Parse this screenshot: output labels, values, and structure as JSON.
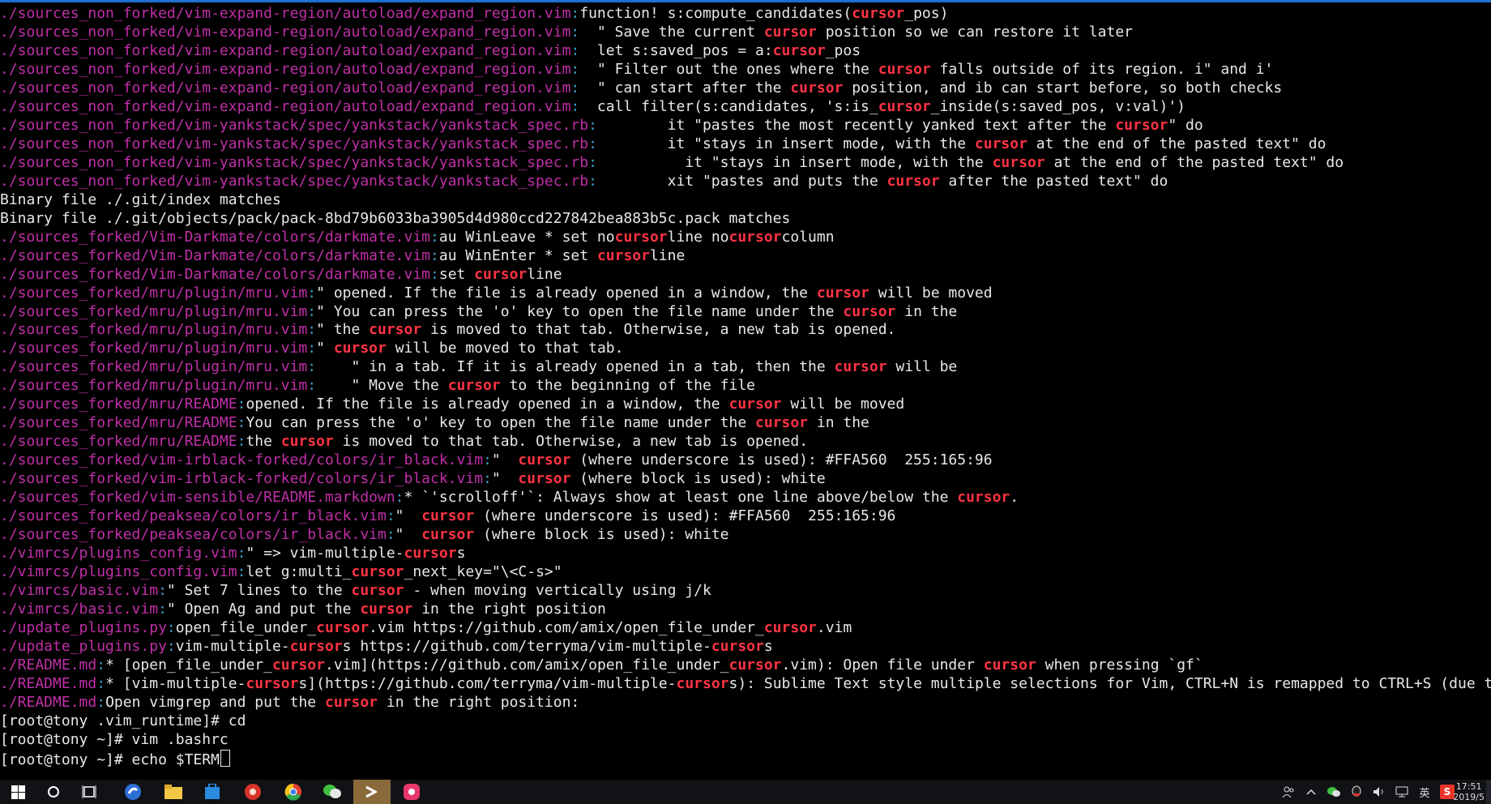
{
  "terminal": {
    "lines": [
      {
        "f": "./sources_non_forked/vim-expand-region/autoload/expand_region.vim",
        "c": "function! s:compute_candidates(cursor_pos)"
      },
      {
        "f": "./sources_non_forked/vim-expand-region/autoload/expand_region.vim",
        "c": "  \" Save the current cursor position so we can restore it later"
      },
      {
        "f": "./sources_non_forked/vim-expand-region/autoload/expand_region.vim",
        "c": "  let s:saved_pos = a:cursor_pos"
      },
      {
        "f": "./sources_non_forked/vim-expand-region/autoload/expand_region.vim",
        "c": "  \" Filter out the ones where the cursor falls outside of its region. i\" and i'"
      },
      {
        "f": "./sources_non_forked/vim-expand-region/autoload/expand_region.vim",
        "c": "  \" can start after the cursor position, and ib can start before, so both checks"
      },
      {
        "f": "./sources_non_forked/vim-expand-region/autoload/expand_region.vim",
        "c": "  call filter(s:candidates, 's:is_cursor_inside(s:saved_pos, v:val)')"
      },
      {
        "f": "./sources_non_forked/vim-yankstack/spec/yankstack/yankstack_spec.rb",
        "c": "        it \"pastes the most recently yanked text after the cursor\" do"
      },
      {
        "f": "./sources_non_forked/vim-yankstack/spec/yankstack/yankstack_spec.rb",
        "c": "        it \"stays in insert mode, with the cursor at the end of the pasted text\" do"
      },
      {
        "f": "./sources_non_forked/vim-yankstack/spec/yankstack/yankstack_spec.rb",
        "c": "          it \"stays in insert mode, with the cursor at the end of the pasted text\" do"
      },
      {
        "f": "./sources_non_forked/vim-yankstack/spec/yankstack/yankstack_spec.rb",
        "c": "        xit \"pastes and puts the cursor after the pasted text\" do"
      },
      {
        "f": "",
        "c": "Binary file ./.git/index matches"
      },
      {
        "f": "",
        "c": "Binary file ./.git/objects/pack/pack-8bd79b6033ba3905d4d980ccd227842bea883b5c.pack matches"
      },
      {
        "f": "./sources_forked/Vim-Darkmate/colors/darkmate.vim",
        "c": "au WinLeave * set nocursorline nocursorcolumn"
      },
      {
        "f": "./sources_forked/Vim-Darkmate/colors/darkmate.vim",
        "c": "au WinEnter * set cursorline"
      },
      {
        "f": "./sources_forked/Vim-Darkmate/colors/darkmate.vim",
        "c": "set cursorline"
      },
      {
        "f": "./sources_forked/mru/plugin/mru.vim",
        "c": "\" opened. If the file is already opened in a window, the cursor will be moved"
      },
      {
        "f": "./sources_forked/mru/plugin/mru.vim",
        "c": "\" You can press the 'o' key to open the file name under the cursor in the"
      },
      {
        "f": "./sources_forked/mru/plugin/mru.vim",
        "c": "\" the cursor is moved to that tab. Otherwise, a new tab is opened."
      },
      {
        "f": "./sources_forked/mru/plugin/mru.vim",
        "c": "\" cursor will be moved to that tab."
      },
      {
        "f": "./sources_forked/mru/plugin/mru.vim",
        "c": "    \" in a tab. If it is already opened in a tab, then the cursor will be"
      },
      {
        "f": "./sources_forked/mru/plugin/mru.vim",
        "c": "    \" Move the cursor to the beginning of the file"
      },
      {
        "f": "./sources_forked/mru/README",
        "c": "opened. If the file is already opened in a window, the cursor will be moved"
      },
      {
        "f": "./sources_forked/mru/README",
        "c": "You can press the 'o' key to open the file name under the cursor in the"
      },
      {
        "f": "./sources_forked/mru/README",
        "c": "the cursor is moved to that tab. Otherwise, a new tab is opened."
      },
      {
        "f": "./sources_forked/vim-irblack-forked/colors/ir_black.vim",
        "c": "\"  cursor (where underscore is used): #FFA560  255:165:96"
      },
      {
        "f": "./sources_forked/vim-irblack-forked/colors/ir_black.vim",
        "c": "\"  cursor (where block is used): white"
      },
      {
        "f": "./sources_forked/vim-sensible/README.markdown",
        "c": "* `'scrolloff'`: Always show at least one line above/below the cursor."
      },
      {
        "f": "./sources_forked/peaksea/colors/ir_black.vim",
        "c": "\"  cursor (where underscore is used): #FFA560  255:165:96"
      },
      {
        "f": "./sources_forked/peaksea/colors/ir_black.vim",
        "c": "\"  cursor (where block is used): white"
      },
      {
        "f": "./vimrcs/plugins_config.vim",
        "c": "\" => vim-multiple-cursors"
      },
      {
        "f": "./vimrcs/plugins_config.vim",
        "c": "let g:multi_cursor_next_key=\"\\<C-s>\""
      },
      {
        "f": "./vimrcs/basic.vim",
        "c": "\" Set 7 lines to the cursor - when moving vertically using j/k"
      },
      {
        "f": "./vimrcs/basic.vim",
        "c": "\" Open Ag and put the cursor in the right position"
      },
      {
        "f": "./update_plugins.py",
        "c": "open_file_under_cursor.vim https://github.com/amix/open_file_under_cursor.vim"
      },
      {
        "f": "./update_plugins.py",
        "c": "vim-multiple-cursors https://github.com/terryma/vim-multiple-cursors"
      },
      {
        "f": "./README.md",
        "c": "* [open_file_under_cursor.vim](https://github.com/amix/open_file_under_cursor.vim): Open file under cursor when pressing `gf`"
      },
      {
        "f": "./README.md",
        "c": "* [vim-multiple-cursors](https://github.com/terryma/vim-multiple-cursors): Sublime Text style multiple selections for Vim, CTRL+N is remapped to CTRL+S (due to YankRing)"
      },
      {
        "f": "./README.md",
        "c": "Open vimgrep and put the cursor in the right position:"
      },
      {
        "f": "",
        "c": "[root@tony .vim_runtime]# cd"
      },
      {
        "f": "",
        "c": "[root@tony ~]# vim .bashrc"
      },
      {
        "f": "",
        "c": "[root@tony ~]# echo $TERM"
      }
    ],
    "highlight_term": "cursor",
    "separator": ":",
    "colors": {
      "filename": "#c02fa8",
      "separator": "#3aa0c8",
      "match": "#ff3344",
      "text": "#e8e8e8",
      "background": "#000000"
    }
  },
  "taskbar": {
    "icons": [
      "windows-start-icon",
      "cortana-search-icon",
      "task-view-icon",
      "browser-icon",
      "file-explorer-icon",
      "store-icon",
      "app-red-icon",
      "chrome-icon",
      "wechat-icon",
      "terminal-icon",
      "camera-app-icon"
    ],
    "tray_icons": [
      "people-icon",
      "chevron-up-icon",
      "wechat-tray-icon",
      "qq-tray-icon",
      "volume-icon",
      "network-icon",
      "ime-icon",
      "sogou-icon"
    ],
    "ime_label": "英",
    "sogou_label": "S",
    "clock_time": "17:51",
    "clock_date": "2019/5"
  }
}
